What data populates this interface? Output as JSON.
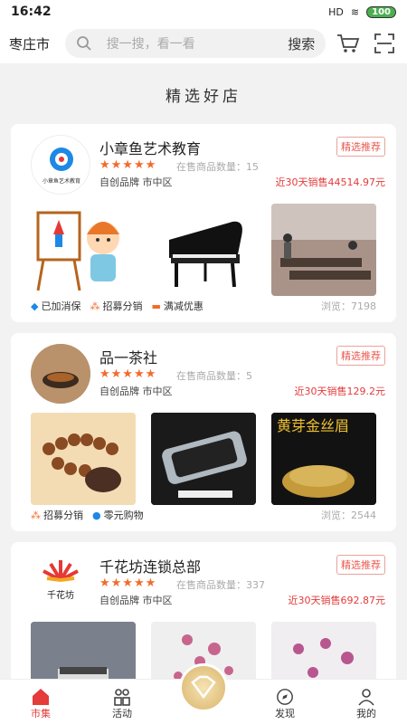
{
  "status": {
    "time": "16:42",
    "battery": "100",
    "net": "HD"
  },
  "header": {
    "city": "枣庄市",
    "search_placeholder": "搜一搜，看一看",
    "search_button": "搜索"
  },
  "section_title": "精选好店",
  "shops": [
    {
      "name": "小章鱼艺术教育",
      "tag": "精选推荐",
      "stars": "★★★★★",
      "count": "在售商品数量：15",
      "meta": "自创品牌  市中区",
      "sales": "近30天销售44514.97元",
      "logo_text": "小章鱼艺术教育",
      "tags": [
        "已加消保",
        "招募分销",
        "满减优惠"
      ],
      "views": "浏览：7198"
    },
    {
      "name": "品一茶社",
      "tag": "精选推荐",
      "stars": "★★★★★",
      "count": "在售商品数量：5",
      "meta": "自创品牌  市中区",
      "sales": "近30天销售129.2元",
      "tags": [
        "招募分销",
        "零元购物"
      ],
      "views": "浏览：2544",
      "img3_text": "黄芽金丝眉"
    },
    {
      "name": "千花坊连锁总部",
      "tag": "精选推荐",
      "stars": "★★★★★",
      "count": "在售商品数量：337",
      "meta": "自创品牌  市中区",
      "sales": "近30天销售692.87元",
      "logo_text": "千花坊"
    }
  ],
  "tabs": [
    "市集",
    "活动",
    "",
    "发现",
    "我的"
  ]
}
